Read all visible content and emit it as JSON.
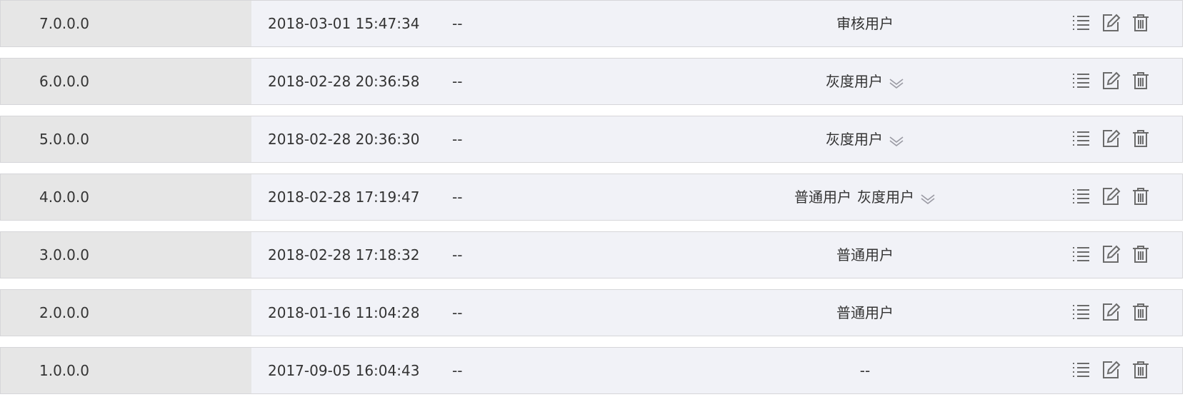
{
  "versions": [
    {
      "version": "7.0.0.0",
      "time": "2018-03-01 15:47:34",
      "note": "--",
      "user_groups": [
        "审核用户"
      ],
      "has_dropdown": false
    },
    {
      "version": "6.0.0.0",
      "time": "2018-02-28 20:36:58",
      "note": "--",
      "user_groups": [
        "灰度用户"
      ],
      "has_dropdown": true
    },
    {
      "version": "5.0.0.0",
      "time": "2018-02-28 20:36:30",
      "note": "--",
      "user_groups": [
        "灰度用户"
      ],
      "has_dropdown": true
    },
    {
      "version": "4.0.0.0",
      "time": "2018-02-28 17:19:47",
      "note": "--",
      "user_groups": [
        "普通用户",
        "灰度用户"
      ],
      "has_dropdown": true
    },
    {
      "version": "3.0.0.0",
      "time": "2018-02-28 17:18:32",
      "note": "--",
      "user_groups": [
        "普通用户"
      ],
      "has_dropdown": false
    },
    {
      "version": "2.0.0.0",
      "time": "2018-01-16 11:04:28",
      "note": "--",
      "user_groups": [
        "普通用户"
      ],
      "has_dropdown": false
    },
    {
      "version": "1.0.0.0",
      "time": "2017-09-05 16:04:43",
      "note": "--",
      "user_groups": [
        "--"
      ],
      "has_dropdown": false
    }
  ],
  "icons": {
    "list": "list-icon",
    "edit": "edit-icon",
    "delete": "trash-icon",
    "dropdown": "chevron-down-double-icon"
  },
  "colors": {
    "row_background": "#f1f2f7",
    "version_cell_background": "#e6e6e6",
    "border": "#d6d6d9",
    "icon": "#6b6b6b",
    "dropdown_icon": "#9a9aa3"
  }
}
